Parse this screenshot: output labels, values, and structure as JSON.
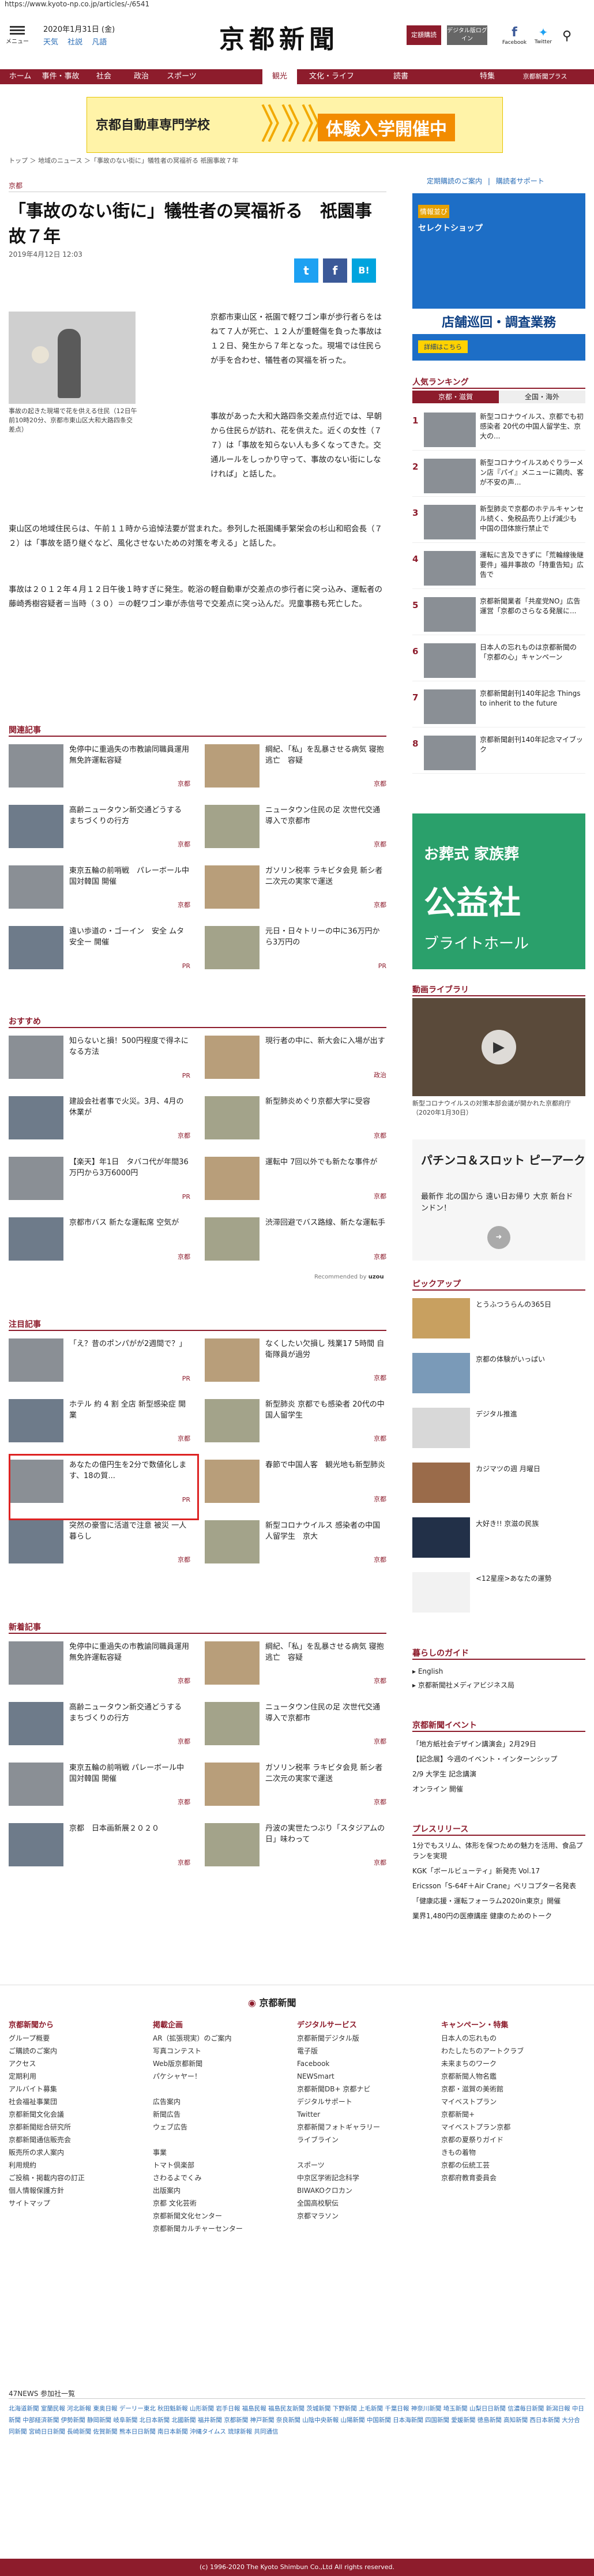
{
  "url": "https://www.kyoto-np.co.jp/articles/-/6541",
  "header": {
    "menu_label": "メニュー",
    "date": "2020年1月31日 (金)",
    "weather": [
      "天気",
      "社説",
      "凡語"
    ],
    "logo": "京都新聞",
    "btn1": "定額購読",
    "btn2": "デジタル版ログイン",
    "social": [
      "Facebook",
      "Twitter"
    ]
  },
  "nav": [
    "ホーム",
    "事件・事故",
    "社会",
    "政治",
    "スポーツ",
    "観光",
    "文化・ライフ",
    "読書",
    "特集",
    "京都新聞プラス"
  ],
  "nav_selected": 2,
  "banner": {
    "t1": "京都自動車専門学校",
    "chev": "》》》",
    "t2": "体験入学開催中"
  },
  "breadcrumb": "トップ ＞ 地域のニュース ＞「事故のない街に」犠牲者の冥福祈る 祇園事故７年",
  "article": {
    "category": "京都",
    "headline": "「事故のない街に」犠牲者の冥福祈る　祇園事故７年",
    "timestamp": "2019年4月12日 12:03",
    "caption": "事故の起きた現場で花を供える住民（12日午前10時20分、京都市東山区大和大路四条交差点）",
    "p1": "京都市東山区・祇園で軽ワゴン車が歩行者らをはねて７人が死亡、１２人が重軽傷を負った事故は１２日、発生から７年となった。現場では住民らが手を合わせ、犠牲者の冥福を祈った。",
    "p2": "事故があった大和大路四条交差点付近では、早朝から住民らが訪れ、花を供えた。近くの女性（７７）は「事故を知らない人も多くなってきた。交通ルールをしっかり守って、事故のない街にしなければ」と話した。",
    "p3": "東山区の地域住民らは、午前１１時から追悼法要が営まれた。参列した祇園縄手繁栄会の杉山和昭会長（７２）は「事故を語り継ぐなど、風化させないための対策を考える」と話した。",
    "p4": "事故は２０１２年４月１２日午後１時すぎに発生。乾浴の軽自動車が交差点の歩行者に突っ込み、運転者の藤崎秀樹容疑者＝当時（３０）＝の軽ワゴン車が赤信号で交差点に突っ込んだ。児童事務も死亡した。"
  },
  "share": [
    "t",
    "f",
    "B!"
  ],
  "sidebar": {
    "links": [
      "定期購読のご案内",
      "購読者サポート"
    ],
    "ad": {
      "l1": "情報並び",
      "l2": "セレクトショップ",
      "l3": "店舗巡回・調査業務",
      "btn": "詳細はこちら"
    },
    "ranking": {
      "title": "人気ランキング",
      "tabs": [
        "京都・滋賀",
        "全国・海外"
      ],
      "items": [
        {
          "n": "1",
          "t": "新型コロナウイルス、京都でも初感染者 20代の中国人留学生、京大の..."
        },
        {
          "n": "2",
          "t": "新型コロナウイルスめぐりラーメン店『パイ』メニューに鶏肉、客が不安の声..."
        },
        {
          "n": "3",
          "t": "新型肺炎で京都のホテルキャンセル続く、免税品売り上げ減少も 中国の団体旅行禁止で"
        },
        {
          "n": "4",
          "t": "運転に言及できずに「荒輪線後継要件」福井事故の「持重告知」広告で"
        },
        {
          "n": "5",
          "t": "京都新聞業者「共産党NO」広告 運営「京都のさらなる発展に..."
        },
        {
          "n": "6",
          "t": "日本人の忘れものは京都新聞の「京都の心」キャンペーン"
        },
        {
          "n": "7",
          "t": "京都新聞創刊140年記念 Things to inherit to the future"
        },
        {
          "n": "8",
          "t": "京都新聞創刊140年記念マイブック"
        }
      ]
    },
    "ad2": {
      "l1": "お葬式 家族葬",
      "l2": "公益社",
      "l3": "ブライトホール"
    },
    "video": {
      "title": "動画ライブラリ",
      "caption": "新型コロナウイルスの対策本部会議が開かれた京都府庁（2020年1月30日）"
    },
    "ad3": {
      "l1": "パチンコ＆スロット ピーアーク",
      "l2": "最新作 北の国から 遠い日お帰り 大京 新台ドンドン！"
    },
    "pickup": {
      "title": "ピックアップ",
      "items": [
        "とうふつうらんの365日",
        "京都の体験がいっぱい",
        "デジタル推進",
        "カジマツの週 月曜日",
        "大好き!! 京滋の民族",
        "<12星座>あなたの運勢"
      ]
    },
    "guide": {
      "title": "暮らしのガイド",
      "items": [
        "English",
        "京都新聞社メディアビジネス局"
      ]
    },
    "events": {
      "title": "京都新聞イベント",
      "items": [
        "「地方紙社会デザイン講演会」2月29日",
        "【記念展】今週のイベント・インターンシップ",
        "2/9 大学生 記念講演",
        "オンライン 開催"
      ]
    },
    "press": {
      "title": "プレスリリース",
      "items": [
        "1分でもスリム、体形を保つための魅力を活用、食品プランを実現",
        "KGK「ボールビューティ」新発売 Vol.17",
        "Ericsson「S-64F＋Air Crane」ベリコプター名発表",
        "「健康応援・運転フォーラム2020in東京」開催",
        "業界1,480円の医療講座 健康のためのトーク"
      ]
    }
  },
  "related": {
    "title": "関連記事",
    "items": [
      {
        "t": "免停中に重過失の市教諭同職員運用 無免許運転容疑",
        "tag": "京都"
      },
      {
        "t": "綱紀、「私」を乱暴させる病気 寝抱逃亡　容疑",
        "tag": "京都"
      },
      {
        "t": "高齢ニュータウン新交通どうする　まちづくりの行方",
        "tag": "京都"
      },
      {
        "t": "ニュータウン住民の足 次世代交通導入で京都市",
        "tag": "京都"
      },
      {
        "t": "東京五輪の前哨戦　パレーボール中国対韓国 開催",
        "tag": "京都"
      },
      {
        "t": "ガソリン税率 ラキビタ会見 新シ者 二次元の実家で運送",
        "tag": "京都"
      },
      {
        "t": "遠い歩道の・ゴーイン　安全 ムタ 安全ー 開催",
        "tag": "PR"
      },
      {
        "t": "元日・日々トリーの中に36万円から3万円の",
        "tag": "PR"
      }
    ]
  },
  "recommend": {
    "title": "おすすめ",
    "items": [
      {
        "t": "知らないと損！500円程度で得ネになる方法",
        "tag": "PR"
      },
      {
        "t": "現行者の中に、新大会に入場が出す",
        "tag": "政治"
      },
      {
        "t": "建設会社者事で火災。3月、4月の休業が",
        "tag": "京都"
      },
      {
        "t": "新型肺炎めぐり京都大学に受容",
        "tag": "京都"
      },
      {
        "t": "【楽天】年1日　タバコ代が年間36万円から3万6000円",
        "tag": "PR"
      },
      {
        "t": "運転中 7回以外でも新たな事件が",
        "tag": "京都"
      },
      {
        "t": "京都市バス 新たな運転席 空気が",
        "tag": "京都"
      },
      {
        "t": "渋滞回避でバス路線、新たな運転手",
        "tag": "京都"
      }
    ],
    "powered": "Recommended by"
  },
  "attention": {
    "title": "注目記事",
    "items": [
      {
        "t": "「え？昔のポンパがが2週間で？」",
        "tag": "PR"
      },
      {
        "t": "なくしたい欠損し 残業17 5時間 自衛隊員が過労",
        "tag": "京都"
      },
      {
        "t": "ホテル 約 4 割 全店 新型感染症 開業",
        "tag": "京都"
      },
      {
        "t": "新型肺炎 京都でも感染者 20代の中国人留学生",
        "tag": "京都"
      },
      {
        "t": "あなたの億円生を2分で数値化します、18の質...",
        "tag": "PR"
      },
      {
        "t": "春節で中国人客　観光地も新型肺炎",
        "tag": "京都"
      },
      {
        "t": "突然の豪雪に活道で注意 被災 一人暮らし",
        "tag": "京都"
      },
      {
        "t": "新型コロナウイルス 感染者の中国人留学生　京大",
        "tag": "京都"
      }
    ]
  },
  "latest": {
    "title": "新着記事",
    "items": [
      {
        "t": "免停中に重過失の市教諭同職員運用 無免許運転容疑",
        "tag": "京都"
      },
      {
        "t": "綱紀、「私」を乱暴させる病気 寝抱逃亡　容疑",
        "tag": "京都"
      },
      {
        "t": "高齢ニュータウン新交通どうする　まちづくりの行方",
        "tag": "京都"
      },
      {
        "t": "ニュータウン住民の足 次世代交通導入で京都市",
        "tag": "京都"
      },
      {
        "t": "東京五輪の前哨戦 パレーボール中国対韓国 開催",
        "tag": "京都"
      },
      {
        "t": "ガソリン税率 ラキビタ会見 新シ者 二次元の実家で運送",
        "tag": "京都"
      },
      {
        "t": "京都　日本画新展２０２０",
        "tag": "京都"
      },
      {
        "t": "丹波の実世たつぶり「スタジアムの日」味わって",
        "tag": "京都"
      }
    ]
  },
  "footer": {
    "brand": "京都新聞",
    "columns": [
      {
        "h": "京都新聞から",
        "items": [
          "グループ概要",
          "ご購読のご案内",
          "アクセス",
          "定期利用",
          "アルバイト募集",
          "社会福祉事業団",
          "京都新聞文化会議",
          "京都新聞総合研究所",
          "京都新聞通信販売会",
          "販売所の求人案内",
          "利用規約",
          "ご投稿・掲載内容の訂正",
          "個人情報保護方針",
          "サイトマップ"
        ]
      },
      {
        "h": "掲載企画",
        "items": [
          "AR（拡張現実）のご案内",
          "写真コンテスト",
          "Web版京都新聞",
          "パケシャヤー！",
          "",
          "広告案内",
          "新聞広告",
          "ウェブ広告",
          "",
          "事業",
          "トマト倶楽部",
          "さわるよでくみ",
          "出版案内",
          "京都 文化芸術",
          "京都新聞文化センター",
          "京都新聞カルチャーセンター"
        ]
      },
      {
        "h": "デジタルサービス",
        "items": [
          "京都新聞デジタル版",
          "電子版",
          "Facebook",
          "NEWSmart",
          "京都新聞DB+ 京都ナビ",
          "デジタルサポート",
          "Twitter",
          "京都新聞フォトギャラリー",
          "ライブライン",
          "",
          "スポーツ",
          "中京区学術記念科学",
          "BIWAKOクロカン",
          "全国高校駅伝",
          "京都マラソン"
        ]
      },
      {
        "h": "キャンペーン・特集",
        "items": [
          "日本人の忘れもの",
          "わたしたちのアートクラブ",
          "未来まちのワーク",
          "京都新聞人物名鑑",
          "京都・滋賀の美術館",
          "マイベストプラン",
          "京都新聞+",
          "マイベストプラン京都",
          "京都の夏祭りガイド",
          "きもの着物",
          "京都の伝統工芸",
          "京都府教育委員会"
        ]
      }
    ],
    "network_title": "47NEWS 参加社一覧",
    "network": "北海道新聞 室蘭民報 河北新報 東奥日報 デーリー東北 秋田魁新報 山形新聞 岩手日報 福島民報 福島民友新聞 茨城新聞 下野新聞 上毛新聞 千葉日報 神奈川新聞 埼玉新聞 山梨日日新聞 信濃毎日新聞 新潟日報 中日新聞 中部経済新聞 伊勢新聞 静岡新聞 岐阜新聞 北日本新聞 北國新聞 福井新聞 京都新聞 神戸新聞 奈良新聞 山陰中央新報 山陽新聞 中国新聞 日本海新聞 四国新聞 愛媛新聞 徳島新聞 高知新聞 西日本新聞 大分合同新聞 宮崎日日新聞 長崎新聞 佐賀新聞 熊本日日新聞 南日本新聞 沖縄タイムス 琉球新報 共同通信",
    "copyright": "(c) 1996-2020 The Kyoto Shimbun Co.,Ltd All rights reserved."
  }
}
